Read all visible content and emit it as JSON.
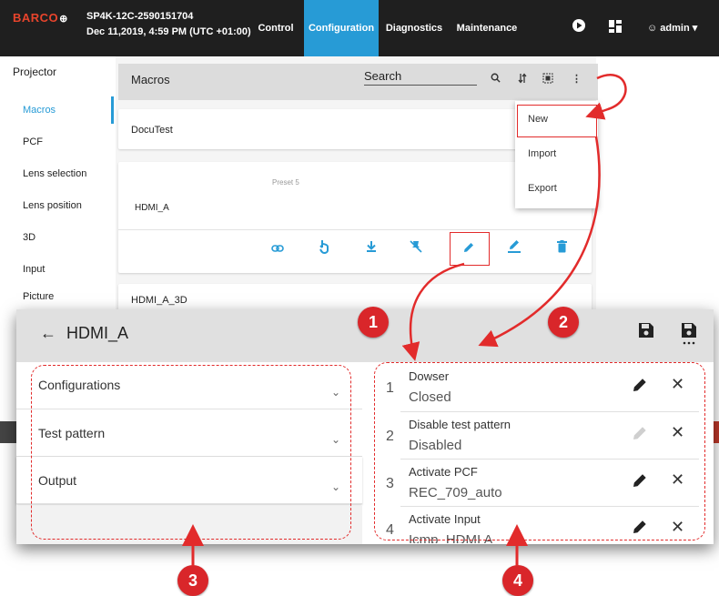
{
  "topbar": {
    "logo": "BARCO",
    "device_name": "SP4K-12C-2590151704",
    "datetime": "Dec 11,2019, 4:59 PM (UTC +01:00)",
    "tabs": [
      {
        "label": "Control"
      },
      {
        "label": "Configuration",
        "active": true
      },
      {
        "label": "Diagnostics"
      },
      {
        "label": "Maintenance"
      }
    ],
    "icons": [
      "play-icon",
      "layout-icon"
    ],
    "user": "admin"
  },
  "sidebar": {
    "title": "Projector",
    "items": [
      {
        "label": "Macros",
        "active": true
      },
      {
        "label": "PCF"
      },
      {
        "label": "Lens selection"
      },
      {
        "label": "Lens position"
      },
      {
        "label": "3D"
      },
      {
        "label": "Input"
      },
      {
        "label": "Picture"
      }
    ]
  },
  "macros": {
    "title": "Macros",
    "search_placeholder": "Search",
    "list": [
      {
        "name": "DocuTest"
      },
      {
        "name": "HDMI_A",
        "subtitle": "Preset 5"
      },
      {
        "name": "HDMI_A_3D"
      }
    ],
    "menu": [
      "New",
      "Import",
      "Export"
    ]
  },
  "editor": {
    "back_arrow": "←",
    "title": "HDMI_A",
    "accordions": [
      {
        "label": "Configurations"
      },
      {
        "label": "Test pattern"
      },
      {
        "label": "Output"
      }
    ],
    "steps": [
      {
        "num": "1",
        "title": "Dowser",
        "value": "Closed",
        "editable": true
      },
      {
        "num": "2",
        "title": "Disable test pattern",
        "value": "Disabled",
        "editable": false
      },
      {
        "num": "3",
        "title": "Activate PCF",
        "value": "REC_709_auto",
        "editable": true
      },
      {
        "num": "4",
        "title": "Activate Input",
        "value": "Icmp_HDMI A",
        "editable": true
      }
    ]
  },
  "callouts": [
    "1",
    "2",
    "3",
    "4"
  ],
  "colors": {
    "accent": "#279bd6",
    "annotation": "#e22b2b",
    "topbar": "#1f1f1f"
  }
}
